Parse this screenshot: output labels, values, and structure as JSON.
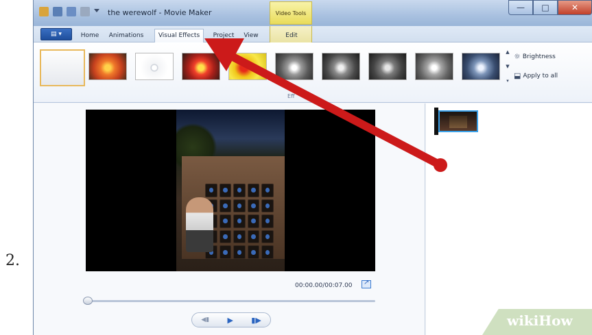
{
  "step": {
    "number": "2."
  },
  "window": {
    "title": "the werewolf - Movie Maker",
    "context_tab_title": "Video Tools",
    "buttons": {
      "minimize": "—",
      "maximize": "□",
      "close": "✕"
    }
  },
  "tabs": [
    "Home",
    "Animations",
    "Visual Effects",
    "Project",
    "View",
    "Edit"
  ],
  "active_tab": "Visual Effects",
  "ribbon": {
    "effects": [
      {
        "name": "No effect",
        "selected": true
      },
      {
        "name": "Orange"
      },
      {
        "name": "Sketch"
      },
      {
        "name": "Red-orange"
      },
      {
        "name": "Yellow"
      },
      {
        "name": "Gray 1"
      },
      {
        "name": "Gray 2"
      },
      {
        "name": "Gray 3"
      },
      {
        "name": "Gray 4"
      },
      {
        "name": "Blue"
      }
    ],
    "brightness_label": "Brightness",
    "apply_all_label": "Apply to all",
    "group_label": "Eff"
  },
  "preview": {
    "timecode": "00:00.00/00:07.00",
    "progress": 0
  },
  "branding": {
    "wikihow": "wikiHow"
  },
  "colors": {
    "arrow": "#cc1a1a",
    "selection": "#e8b85a",
    "accent": "#2a64c0"
  }
}
